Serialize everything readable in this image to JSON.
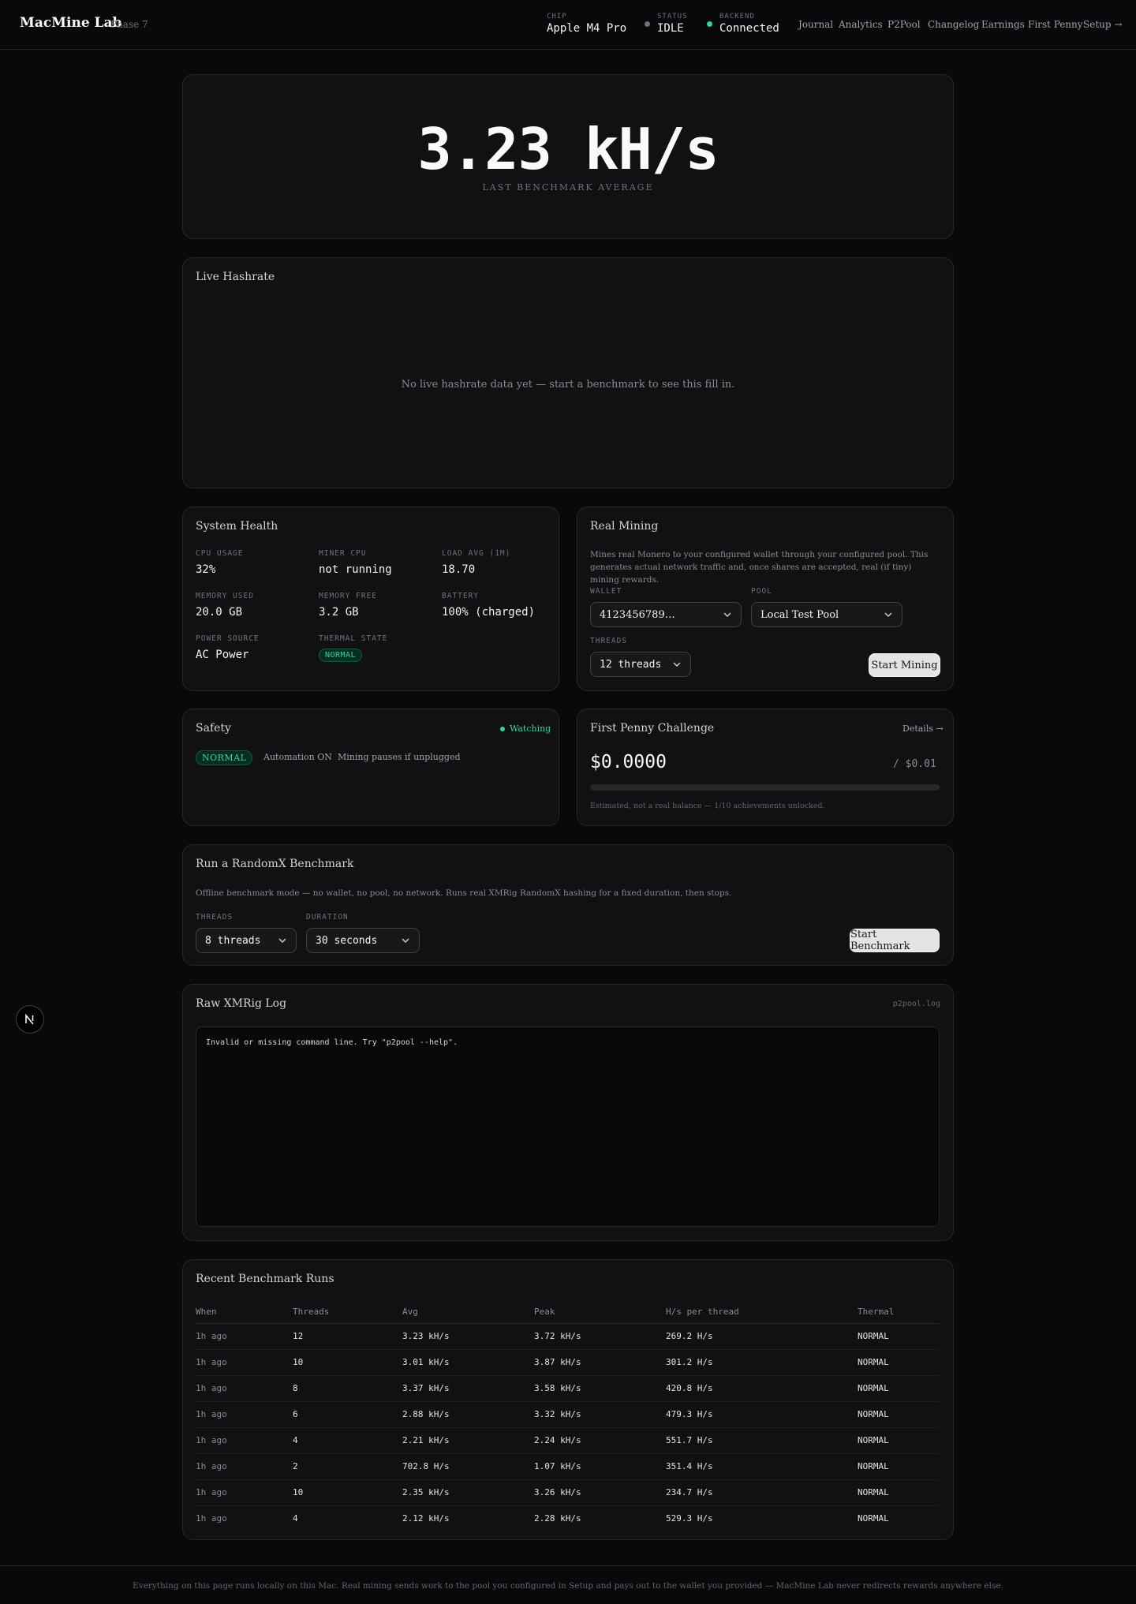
{
  "header": {
    "brand": "MacMine Lab",
    "phase": "Phase 7",
    "chip": {
      "label": "CHIP",
      "value": "Apple M4 Pro"
    },
    "status": {
      "label": "STATUS",
      "value": "IDLE"
    },
    "backend": {
      "label": "BACKEND",
      "value": "Connected"
    },
    "nav": [
      "Journal",
      "Analytics",
      "P2Pool",
      "Changelog",
      "Earnings",
      "First Penny",
      "Setup →"
    ]
  },
  "hero": {
    "value": "3.23 kH/s",
    "subtitle": "LAST BENCHMARK AVERAGE"
  },
  "live": {
    "title": "Live Hashrate",
    "empty": "No live hashrate data yet — start a benchmark to see this fill in."
  },
  "health": {
    "title": "System Health",
    "metrics": [
      {
        "label": "CPU USAGE",
        "value": "32%"
      },
      {
        "label": "MINER CPU",
        "value": "not running"
      },
      {
        "label": "LOAD AVG (1M)",
        "value": "18.70"
      },
      {
        "label": "MEMORY USED",
        "value": "20.0 GB"
      },
      {
        "label": "MEMORY FREE",
        "value": "3.2 GB"
      },
      {
        "label": "BATTERY",
        "value": "100% (charged)"
      },
      {
        "label": "POWER SOURCE",
        "value": "AC Power"
      },
      {
        "label": "THERMAL STATE",
        "value": "NORMAL"
      }
    ]
  },
  "mining": {
    "title": "Real Mining",
    "description": "Mines real Monero to your configured wallet through your configured pool. This generates actual network traffic and, once shares are accepted, real (if tiny) mining rewards.",
    "wallet_label": "WALLET",
    "wallet_value": "4123456789…",
    "pool_label": "POOL",
    "pool_value": "Local Test Pool",
    "threads_label": "THREADS",
    "threads_value": "12 threads",
    "start_label": "Start Mining"
  },
  "safety": {
    "title": "Safety",
    "watching": "Watching",
    "badge": "NORMAL",
    "automation": "Automation ON",
    "note": "Mining pauses if unplugged"
  },
  "penny": {
    "title": "First Penny Challenge",
    "details": "Details →",
    "amount": "$0.0000",
    "goal": "/ $0.01",
    "progress": 0,
    "note": "Estimated, not a real balance — 1/10 achievements unlocked."
  },
  "benchmark": {
    "title": "Run a RandomX Benchmark",
    "description": "Offline benchmark mode — no wallet, no pool, no network. Runs real XMRig RandomX hashing for a fixed duration, then stops.",
    "threads_label": "THREADS",
    "threads_value": "8 threads",
    "duration_label": "DURATION",
    "duration_value": "30 seconds",
    "start_label": "Start Benchmark"
  },
  "log": {
    "title": "Raw XMRig Log",
    "source": "p2pool.log",
    "text": "Invalid or missing command line. Try \"p2pool --help\"."
  },
  "runs": {
    "title": "Recent Benchmark Runs",
    "columns": [
      "When",
      "Threads",
      "Avg",
      "Peak",
      "H/s per thread",
      "Thermal"
    ],
    "rows": [
      [
        "1h ago",
        "12",
        "3.23 kH/s",
        "3.72 kH/s",
        "269.2 H/s",
        "NORMAL"
      ],
      [
        "1h ago",
        "10",
        "3.01 kH/s",
        "3.87 kH/s",
        "301.2 H/s",
        "NORMAL"
      ],
      [
        "1h ago",
        "8",
        "3.37 kH/s",
        "3.58 kH/s",
        "420.8 H/s",
        "NORMAL"
      ],
      [
        "1h ago",
        "6",
        "2.88 kH/s",
        "3.32 kH/s",
        "479.3 H/s",
        "NORMAL"
      ],
      [
        "1h ago",
        "4",
        "2.21 kH/s",
        "2.24 kH/s",
        "551.7 H/s",
        "NORMAL"
      ],
      [
        "1h ago",
        "2",
        "702.8 H/s",
        "1.07 kH/s",
        "351.4 H/s",
        "NORMAL"
      ],
      [
        "1h ago",
        "10",
        "2.35 kH/s",
        "3.26 kH/s",
        "234.7 H/s",
        "NORMAL"
      ],
      [
        "1h ago",
        "4",
        "2.12 kH/s",
        "2.28 kH/s",
        "529.3 H/s",
        "NORMAL"
      ]
    ]
  },
  "footer": {
    "text": "Everything on this page runs locally on this Mac. Real mining sends work to the pool you configured in Setup and pays out to the wallet you provided — MacMine Lab never redirects rewards anywhere else."
  },
  "devtools": {
    "icon": "next-logo-icon"
  },
  "colors": {
    "accent": "#34d399",
    "background": "#09090b",
    "card": "#111113",
    "status_idle": "#71717a"
  }
}
